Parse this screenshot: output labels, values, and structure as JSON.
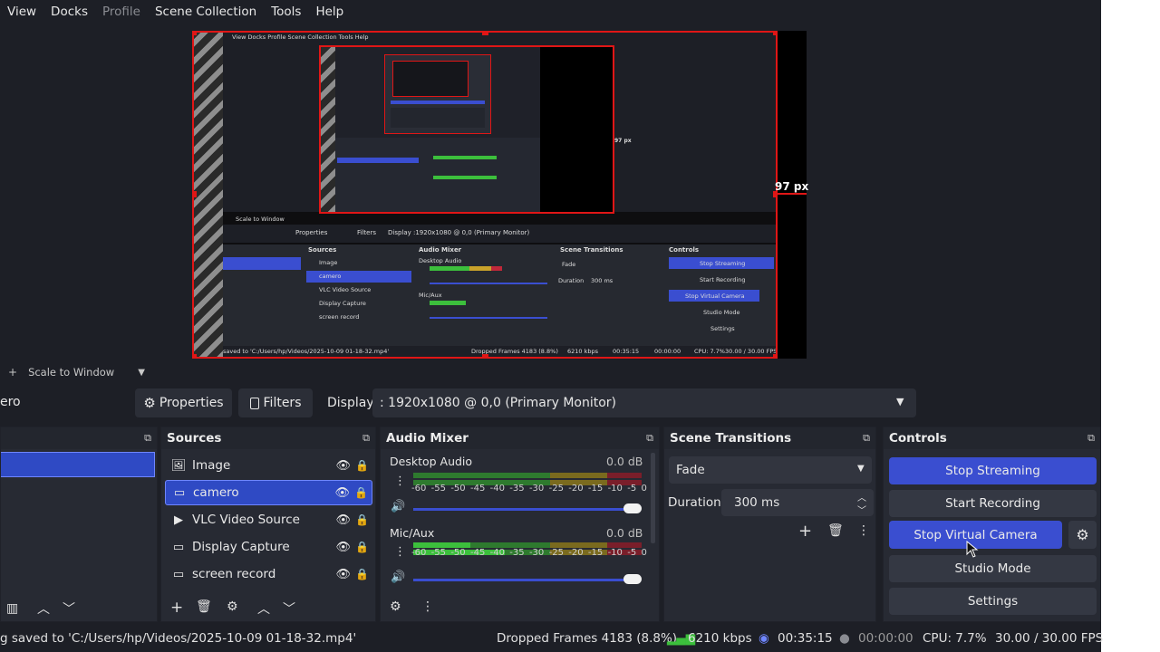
{
  "menu": {
    "items": [
      {
        "label": "View",
        "dim": false
      },
      {
        "label": "Docks",
        "dim": false
      },
      {
        "label": "Profile",
        "dim": true
      },
      {
        "label": "Scene Collection",
        "dim": false
      },
      {
        "label": "Tools",
        "dim": false
      },
      {
        "label": "Help",
        "dim": false
      }
    ]
  },
  "preview": {
    "offset_label": "97 px",
    "mini": {
      "menu": "View  Docks  Profile  Scene Collection  Tools  Help",
      "scale": "Scale to Window",
      "properties": "Properties",
      "filters": "Filters",
      "display": "Display",
      "display_value": ":1920x1080 @ 0,0 (Primary Monitor)",
      "sources_title": "Sources",
      "audio_title": "Audio Mixer",
      "transitions_title": "Scene Transitions",
      "controls_title": "Controls",
      "sources": [
        "Image",
        "camero",
        "VLC Video Source",
        "Display Capture",
        "screen record"
      ],
      "desktop_audio": "Desktop Audio",
      "mic_aux": "Mic/Aux",
      "fade": "Fade",
      "duration": "Duration",
      "duration_value": "300 ms",
      "controls": [
        "Stop Streaming",
        "Start Recording",
        "Stop Virtual Camera",
        "Studio Mode",
        "Settings"
      ],
      "status": "saved to 'C:/Users/hp/Videos/2025-10-09 01-18-32.mp4'",
      "dropped": "Dropped Frames 4183 (8.8%)",
      "kbps": "6210 kbps",
      "time": "00:35:15",
      "rec": "00:00:00",
      "cpu": "CPU: 7.7%",
      "fps": "30.00 / 30.00 FPS",
      "offset_label": "97 px"
    }
  },
  "scalebar": {
    "label": "Scale to Window"
  },
  "toolbar": {
    "scene_name_fragment": "ero",
    "properties": "Properties",
    "filters": "Filters",
    "display_label": "Display",
    "display_value": ": 1920x1080 @ 0,0 (Primary Monitor)"
  },
  "sources": {
    "title": "Sources",
    "items": [
      {
        "label": "Image",
        "icon": "image-icon"
      },
      {
        "label": "camero",
        "icon": "monitor-icon"
      },
      {
        "label": "VLC Video Source",
        "icon": "play-icon"
      },
      {
        "label": "Display Capture",
        "icon": "monitor-icon"
      },
      {
        "label": "screen record",
        "icon": "monitor-icon"
      }
    ]
  },
  "audio": {
    "title": "Audio Mixer",
    "channels": [
      {
        "name": "Desktop Audio",
        "db": "0.0 dB"
      },
      {
        "name": "Mic/Aux",
        "db": "0.0 dB"
      }
    ],
    "scale": [
      "-60",
      "-55",
      "-50",
      "-45",
      "-40",
      "-35",
      "-30",
      "-25",
      "-20",
      "-15",
      "-10",
      "-5",
      "0"
    ]
  },
  "transitions": {
    "title": "Scene Transitions",
    "type": "Fade",
    "duration_label": "Duration",
    "duration_value": "300 ms"
  },
  "controls": {
    "title": "Controls",
    "stop_streaming": "Stop Streaming",
    "start_recording": "Start Recording",
    "stop_virtual_camera": "Stop Virtual Camera",
    "studio_mode": "Studio Mode",
    "settings": "Settings"
  },
  "status": {
    "saved": "g saved to 'C:/Users/hp/Videos/2025-10-09 01-18-32.mp4'",
    "dropped": "Dropped Frames 4183 (8.8%)",
    "kbps": "6210 kbps",
    "stream_time": "00:35:15",
    "rec_time": "00:00:00",
    "cpu": "CPU: 7.7%",
    "fps": "30.00 / 30.00 FPS"
  },
  "colors": {
    "accent_blue": "#3a4ed0",
    "selection_red": "#e01616",
    "meter_green": "#3cbf3c",
    "meter_yellow": "#c9a22a",
    "meter_red": "#c0283a"
  }
}
